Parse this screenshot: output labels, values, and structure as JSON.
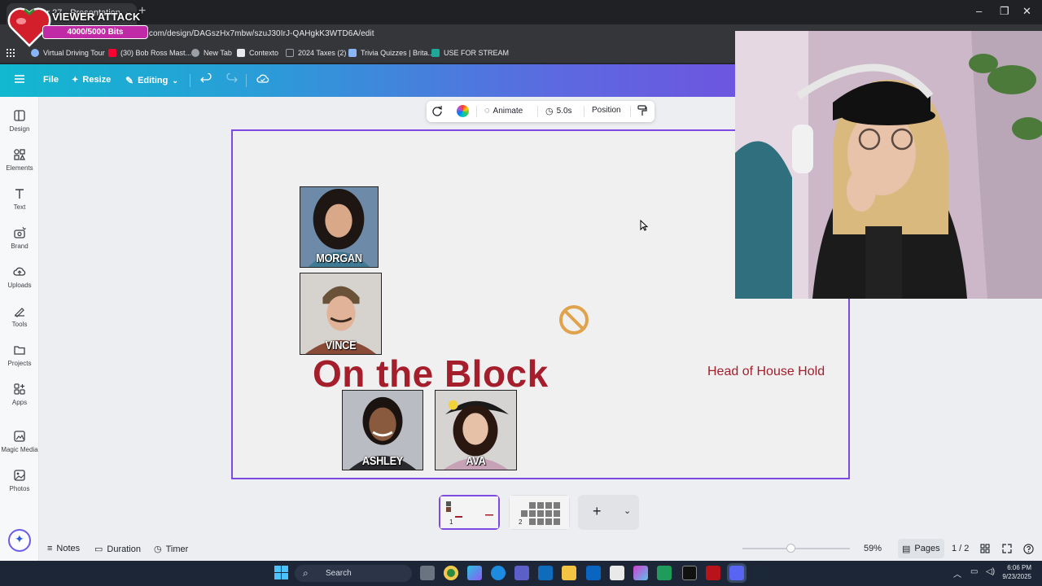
{
  "browser": {
    "tab_title": "...her 27 - Presentation",
    "tab_close": "×",
    "new_tab": "+",
    "url": ".com/design/DAGszHx7mbw/szuJ30IrJ-QAHgkK3WTD6A/edit",
    "window_controls": [
      "–",
      "❐",
      "✕"
    ],
    "bookmarks": [
      {
        "label": "Virtual Driving Tour",
        "icon": "globe-icon",
        "color": "#8ab4f8"
      },
      {
        "label": "(30) Bob Ross Mast...",
        "icon": "youtube-icon",
        "color": "#ff0033"
      },
      {
        "label": "New Tab",
        "icon": "chrome-icon",
        "color": "#9aa0a6"
      },
      {
        "label": "Contexto",
        "icon": "contexto-icon",
        "color": "#e8eaed"
      },
      {
        "label": "2024 Taxes (2)",
        "icon": "folder-icon",
        "color": "#9aa0a6"
      },
      {
        "label": "Trivia Quizzes | Brita...",
        "icon": "trivia-icon",
        "color": "#8ab4f8"
      },
      {
        "label": "USE FOR STREAM",
        "icon": "stream-icon",
        "color": "#1fa89a"
      }
    ]
  },
  "overlay": {
    "title": "VIEWER ATTACK",
    "bits": "4000/5000 Bits"
  },
  "canva": {
    "toolbar": {
      "file": "File",
      "resize": "Resize",
      "editing": "Editing"
    },
    "sidebar": [
      {
        "label": "Design",
        "icon": "design-icon"
      },
      {
        "label": "Elements",
        "icon": "elements-icon"
      },
      {
        "label": "Text",
        "icon": "text-icon"
      },
      {
        "label": "Brand",
        "icon": "brand-icon"
      },
      {
        "label": "Uploads",
        "icon": "uploads-icon"
      },
      {
        "label": "Tools",
        "icon": "tools-icon"
      },
      {
        "label": "Projects",
        "icon": "projects-icon"
      },
      {
        "label": "Apps",
        "icon": "apps-icon"
      },
      {
        "label": "Magic Media",
        "icon": "magic-media-icon"
      },
      {
        "label": "Photos",
        "icon": "photos-icon"
      }
    ],
    "element_toolbar": {
      "animate": "Animate",
      "duration": "5.0s",
      "position": "Position"
    },
    "slide": {
      "title": "On the Block",
      "subtitle": "Head of House Hold",
      "people": [
        {
          "name": "MORGAN",
          "bg": "#6d8aa8",
          "skin": "#d9a889",
          "hair": "#1e1612"
        },
        {
          "name": "VINCE",
          "bg": "#8a4a38",
          "skin": "#e1b49a",
          "hair": "#6a5238"
        },
        {
          "name": "ASHLEY",
          "bg": "#b9bcc2",
          "skin": "#8a5a3e",
          "hair": "#1a1310"
        },
        {
          "name": "AVA",
          "bg": "#c7a1b6",
          "skin": "#e7c0a8",
          "hair": "#2a1810"
        }
      ]
    },
    "bottom": {
      "notes": "Notes",
      "duration": "Duration",
      "timer": "Timer",
      "zoom": "59%",
      "pages": "Pages",
      "page_count": "1 / 2",
      "add_page": "+",
      "thumb1_number": "1",
      "thumb2_number": "2"
    }
  },
  "taskbar": {
    "search": "Search",
    "time": "6:06 PM",
    "date": "9/23/2025"
  }
}
